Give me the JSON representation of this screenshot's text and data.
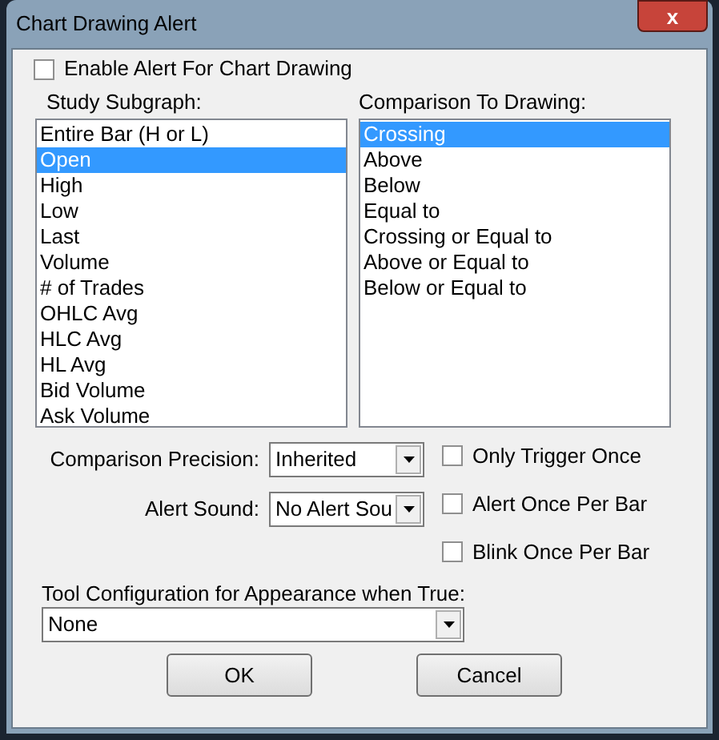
{
  "window": {
    "title": "Chart Drawing Alert",
    "close": "x"
  },
  "enable_alert": {
    "label": "Enable Alert For Chart Drawing",
    "checked": false
  },
  "study_subgraph": {
    "label": "Study Subgraph:",
    "items": [
      {
        "label": "Entire Bar (H or L)",
        "selected": false
      },
      {
        "label": "Open",
        "selected": true
      },
      {
        "label": "High",
        "selected": false
      },
      {
        "label": "Low",
        "selected": false
      },
      {
        "label": "Last",
        "selected": false
      },
      {
        "label": "Volume",
        "selected": false
      },
      {
        "label": "# of Trades",
        "selected": false
      },
      {
        "label": "OHLC Avg",
        "selected": false
      },
      {
        "label": "HLC Avg",
        "selected": false
      },
      {
        "label": "HL Avg",
        "selected": false
      },
      {
        "label": "Bid Volume",
        "selected": false
      },
      {
        "label": "Ask Volume",
        "selected": false
      }
    ]
  },
  "comparison": {
    "label": "Comparison To Drawing:",
    "items": [
      {
        "label": "Crossing",
        "selected": true
      },
      {
        "label": "Above",
        "selected": false
      },
      {
        "label": "Below",
        "selected": false
      },
      {
        "label": "Equal to",
        "selected": false
      },
      {
        "label": "Crossing or Equal to",
        "selected": false
      },
      {
        "label": "Above or Equal to",
        "selected": false
      },
      {
        "label": "Below or Equal to",
        "selected": false
      }
    ]
  },
  "comparison_precision": {
    "label": "Comparison Precision:",
    "value": "Inherited"
  },
  "alert_sound": {
    "label": "Alert Sound:",
    "value": "No Alert Sou"
  },
  "options": [
    {
      "label": "Only Trigger Once",
      "checked": false
    },
    {
      "label": "Alert Once Per Bar",
      "checked": false
    },
    {
      "label": "Blink Once Per Bar",
      "checked": false
    }
  ],
  "tool_configuration": {
    "label": "Tool Configuration for Appearance when True:",
    "value": "None"
  },
  "buttons": [
    "OK",
    "Cancel"
  ]
}
